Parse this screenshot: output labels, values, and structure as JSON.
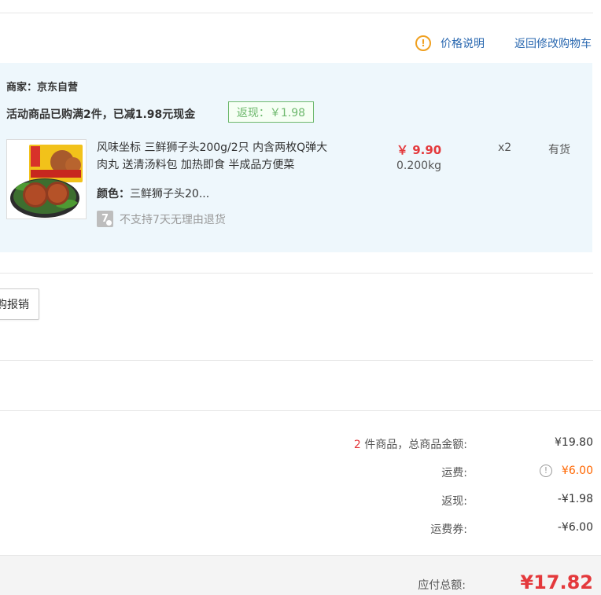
{
  "links": {
    "price_info": "价格说明",
    "back_to_cart": "返回修改购物车"
  },
  "seller": {
    "label": "商家：京东自营"
  },
  "promotion": {
    "text": "活动商品已购满2件，已减1.98元现金",
    "rebate_badge": "返现：￥1.98"
  },
  "product": {
    "name": "风味坐标 三鲜狮子头200g/2只 内含两枚Q弹大肉丸 送清汤料包 加热即食 半成品方便菜",
    "color_label": "颜色：",
    "color_value": "三鲜狮子头20...",
    "return_policy_icon": "7",
    "return_policy": "不支持7天无理由退货",
    "price": "￥ 9.90",
    "weight": "0.200kg",
    "quantity": "x2",
    "stock": "有货"
  },
  "reimburse_button": "购报销",
  "summary": {
    "count": "2",
    "goods_label": " 件商品，总商品金额:",
    "goods_value": "¥19.80",
    "shipping_label": "运费:",
    "shipping_info_icon": "!",
    "shipping_value": "¥6.00",
    "rebate_label": "返现:",
    "rebate_value": "-¥1.98",
    "coupon_label": "运费券:",
    "coupon_value": "-¥6.00",
    "total_label": "应付总额:",
    "total_value": "¥17.82"
  },
  "colors": {
    "link": "#2a68b0",
    "price_red": "#e4393c",
    "shipping_orange": "#ff6600",
    "panel_bg": "#eef7fc",
    "rebate_green": "#6db86d"
  }
}
